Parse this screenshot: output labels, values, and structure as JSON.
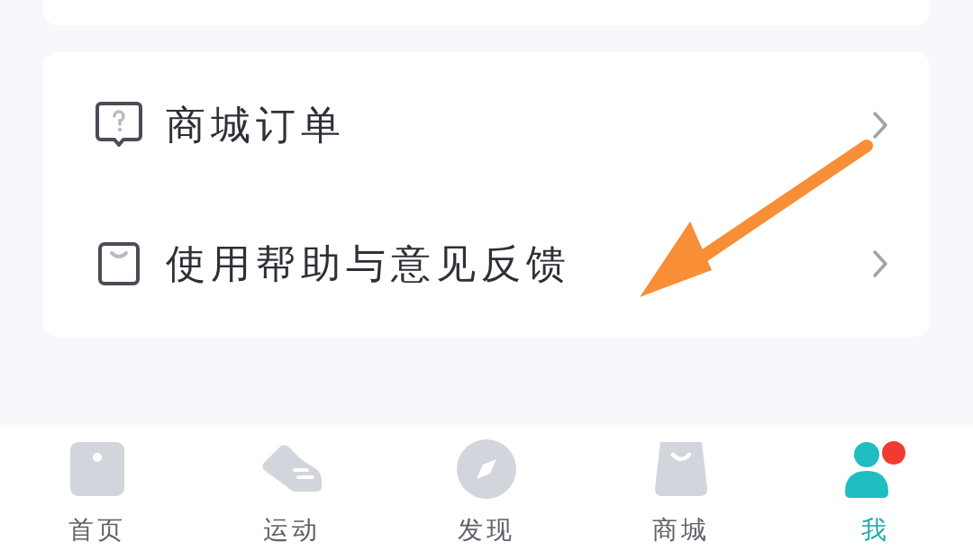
{
  "menu_items": [
    {
      "kind": "help",
      "label": "商城订单"
    },
    {
      "kind": "bag",
      "label": "使用帮助与意见反馈"
    }
  ],
  "annotation": {
    "kind": "arrow"
  },
  "tab_bar": [
    {
      "kind": "home",
      "label": "首页",
      "selected": false
    },
    {
      "kind": "shoe",
      "label": "运动",
      "selected": false
    },
    {
      "kind": "compass",
      "label": "发现",
      "selected": false
    },
    {
      "kind": "shop",
      "label": "商城",
      "selected": false
    },
    {
      "kind": "me",
      "label": "我",
      "selected": true
    }
  ]
}
